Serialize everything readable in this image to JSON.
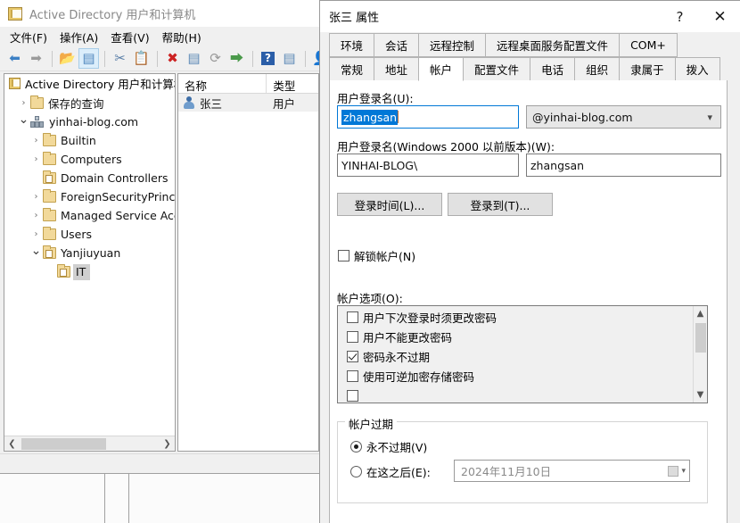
{
  "mmc": {
    "title": "Active Directory 用户和计算机",
    "title_icon": "console-icon",
    "menu": [
      {
        "label": "文件(F)",
        "name": "menu-file"
      },
      {
        "label": "操作(A)",
        "name": "menu-action"
      },
      {
        "label": "查看(V)",
        "name": "menu-view"
      },
      {
        "label": "帮助(H)",
        "name": "menu-help"
      }
    ],
    "toolbar": [
      {
        "icon": "back-arrow-icon",
        "glyph": "⬅",
        "color": "#3b7fc4"
      },
      {
        "icon": "forward-arrow-icon",
        "glyph": "➡",
        "color": "#9a9a9a"
      },
      {
        "sep": true
      },
      {
        "icon": "up-folder-icon",
        "glyph": "📂",
        "color": "#d8a43c"
      },
      {
        "icon": "show-hide-tree-icon",
        "glyph": "▤",
        "color": "#4f86bd",
        "active": true
      },
      {
        "sep": true
      },
      {
        "icon": "cut-icon",
        "glyph": "✂",
        "color": "#5a7fa8"
      },
      {
        "icon": "paste-icon",
        "glyph": "📋",
        "color": "#6b6b6b"
      },
      {
        "sep": true
      },
      {
        "icon": "delete-icon",
        "glyph": "✖",
        "color": "#cc2222"
      },
      {
        "icon": "properties-icon",
        "glyph": "▤",
        "color": "#5a87b5"
      },
      {
        "icon": "refresh-icon",
        "glyph": "⟳",
        "color": "#9a9a9a"
      },
      {
        "icon": "export-list-icon",
        "glyph": "⮕",
        "color": "#4b9a4b"
      },
      {
        "sep": true
      },
      {
        "icon": "help-icon",
        "glyph": "?",
        "color": "#ffffff",
        "bg": "#2b5ea8"
      },
      {
        "icon": "run-console-icon",
        "glyph": "▤",
        "color": "#5a87b5"
      },
      {
        "sep": true
      },
      {
        "icon": "new-user-icon",
        "glyph": "👤",
        "color": "#c8923c"
      },
      {
        "icon": "new-group-icon",
        "glyph": "👥",
        "color": "#c8923c"
      }
    ],
    "tree": {
      "root": {
        "label": "Active Directory 用户和计算机",
        "icon": "console-root-icon"
      },
      "items": [
        {
          "label": "保存的查询",
          "indent": 1,
          "chevron": "closed",
          "icon": "folder-icon",
          "selected": false
        },
        {
          "label": "yinhai-blog.com",
          "indent": 1,
          "chevron": "open",
          "icon": "domain-icon",
          "selected": false
        },
        {
          "label": "Builtin",
          "indent": 2,
          "chevron": "closed",
          "icon": "folder-icon",
          "selected": false
        },
        {
          "label": "Computers",
          "indent": 2,
          "chevron": "closed",
          "icon": "folder-icon",
          "selected": false
        },
        {
          "label": "Domain Controllers",
          "indent": 2,
          "chevron": "none",
          "icon": "ou-folder-icon",
          "selected": false
        },
        {
          "label": "ForeignSecurityPrincipa",
          "indent": 2,
          "chevron": "closed",
          "icon": "folder-icon",
          "selected": false
        },
        {
          "label": "Managed Service Accc",
          "indent": 2,
          "chevron": "closed",
          "icon": "folder-icon",
          "selected": false
        },
        {
          "label": "Users",
          "indent": 2,
          "chevron": "closed",
          "icon": "folder-icon",
          "selected": false
        },
        {
          "label": "Yanjiuyuan",
          "indent": 2,
          "chevron": "open",
          "icon": "ou-folder-icon",
          "selected": false
        },
        {
          "label": "IT",
          "indent": 3,
          "chevron": "none",
          "icon": "ou-folder-icon",
          "selected": true
        }
      ]
    },
    "list": {
      "columns": [
        "名称",
        "类型"
      ],
      "rows": [
        {
          "name": "张三",
          "type": "用户",
          "icon": "user-icon"
        }
      ]
    }
  },
  "dialog": {
    "title": "张三 属性",
    "help_button": "?",
    "close_button": "✕",
    "tabs_row1": [
      "环境",
      "会话",
      "远程控制",
      "远程桌面服务配置文件",
      "COM+"
    ],
    "tabs_row2": [
      "常规",
      "地址",
      "帐户",
      "配置文件",
      "电话",
      "组织",
      "隶属于",
      "拨入"
    ],
    "selected_tab": "帐户",
    "account": {
      "logon_name_label": "用户登录名(U):",
      "logon_name_value": "zhangsan",
      "upn_suffix": "@yinhai-blog.com",
      "pre2000_label": "用户登录名(Windows 2000 以前版本)(W):",
      "pre2000_domain": "YINHAI-BLOG\\",
      "pre2000_value": "zhangsan",
      "logon_hours_button": "登录时间(L)...",
      "log_on_to_button": "登录到(T)...",
      "unlock_label": "解锁帐户(N)",
      "unlock_checked": false,
      "options_label": "帐户选项(O):",
      "options": [
        {
          "label": "用户下次登录时须更改密码",
          "checked": false
        },
        {
          "label": "用户不能更改密码",
          "checked": false
        },
        {
          "label": "密码永不过期",
          "checked": true
        },
        {
          "label": "使用可逆加密存储密码",
          "checked": false
        }
      ],
      "expiry": {
        "group_title": "帐户过期",
        "never_label": "永不过期(V)",
        "end_of_label": "在这之后(E):",
        "selected": "never",
        "end_date": "2024年11月10日"
      }
    }
  },
  "colors": {
    "accent": "#0078d7",
    "dialog_bg": "#f0f0f0",
    "tab_body": "#ffffff",
    "selection": "#cfcfcf"
  }
}
